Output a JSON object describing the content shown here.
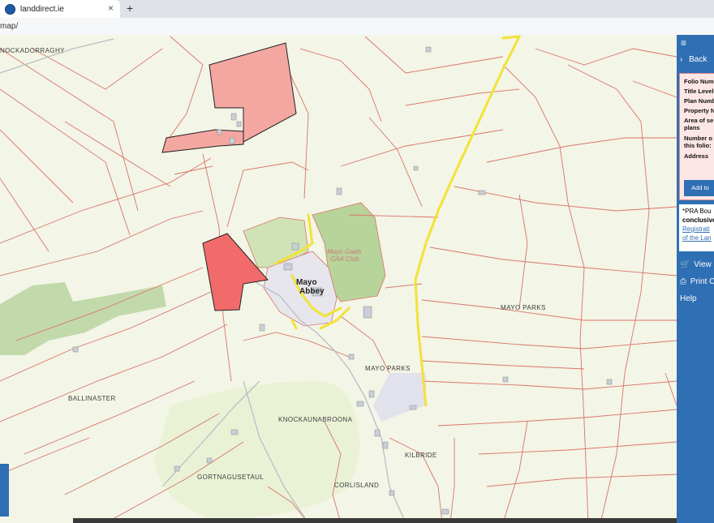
{
  "browser": {
    "tab_title": "landdirect.ie",
    "tab_close": "×",
    "new_tab": "+",
    "url": "map/"
  },
  "map": {
    "place_labels": [
      {
        "text": "NOCKADORRAGHY"
      },
      {
        "text": "MAYO PARKS"
      },
      {
        "text": "MAYO PARKS"
      },
      {
        "text": "BALLINASTER"
      },
      {
        "text": "KNOCKAUNABROONA"
      },
      {
        "text": "KILBRIDE"
      },
      {
        "text": "GORTNAGUSETAUL"
      },
      {
        "text": "CORLISLAND"
      }
    ],
    "town_line1": "Mayo",
    "town_line2": "Abbey",
    "club_line1": "Mayo Gaels",
    "club_line2": "GAA Club",
    "colors": {
      "land": "#f3f5e6",
      "boundary": "#d9746a",
      "road_yellow": "#f2e337",
      "selected_parcel": "#f26b6b",
      "nearby_parcel": "#f4a7a1",
      "forest": "#b8d3a0",
      "panel_blue": "#2f6fb3"
    }
  },
  "panel": {
    "menu_icon": "≡",
    "back_label": "Back",
    "folio_fields": [
      "Folio Numb",
      "Title Level",
      "Plan Numb",
      "Property N",
      "Area of se",
      "plans",
      "Number o",
      "this folio:",
      "Address"
    ],
    "add_button": "Add to",
    "note_lines": [
      "*PRA Bou",
      "conclusive",
      "Registrati",
      "of the Lan"
    ],
    "view_label": "View B",
    "print_label": "Print C",
    "help_label": "Help"
  }
}
